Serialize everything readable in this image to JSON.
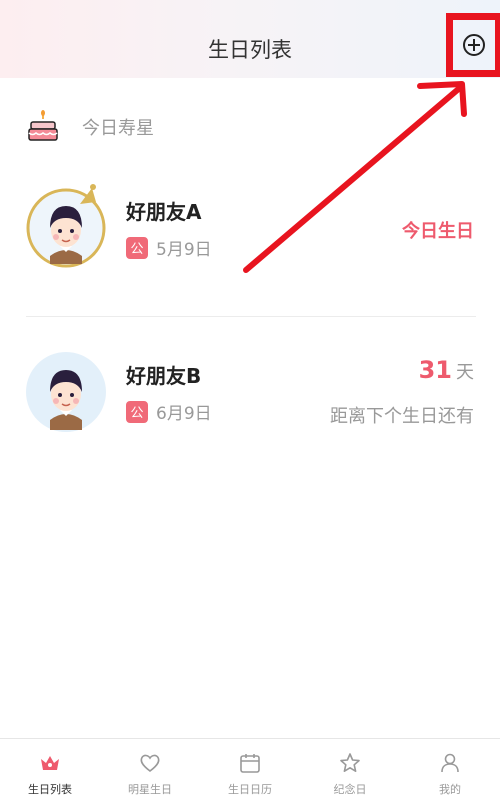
{
  "header": {
    "title": "生日列表"
  },
  "today_section": {
    "label": "今日寿星"
  },
  "friends": [
    {
      "name": "好朋友A",
      "calendar_badge": "公",
      "date": "5月9日",
      "status": "今日生日"
    },
    {
      "name": "好朋友B",
      "calendar_badge": "公",
      "date": "6月9日",
      "days_count": "31",
      "days_unit": "天",
      "countdown_label": "距离下个生日还有"
    }
  ],
  "tabs": [
    {
      "label": "生日列表",
      "icon": "crown-icon",
      "active": true
    },
    {
      "label": "明星生日",
      "icon": "heart-icon",
      "active": false
    },
    {
      "label": "生日日历",
      "icon": "calendar-icon",
      "active": false
    },
    {
      "label": "纪念日",
      "icon": "star-icon",
      "active": false
    },
    {
      "label": "我的",
      "icon": "person-icon",
      "active": false
    }
  ],
  "colors": {
    "accent": "#ee5a6d",
    "annotation": "#e8141f"
  }
}
